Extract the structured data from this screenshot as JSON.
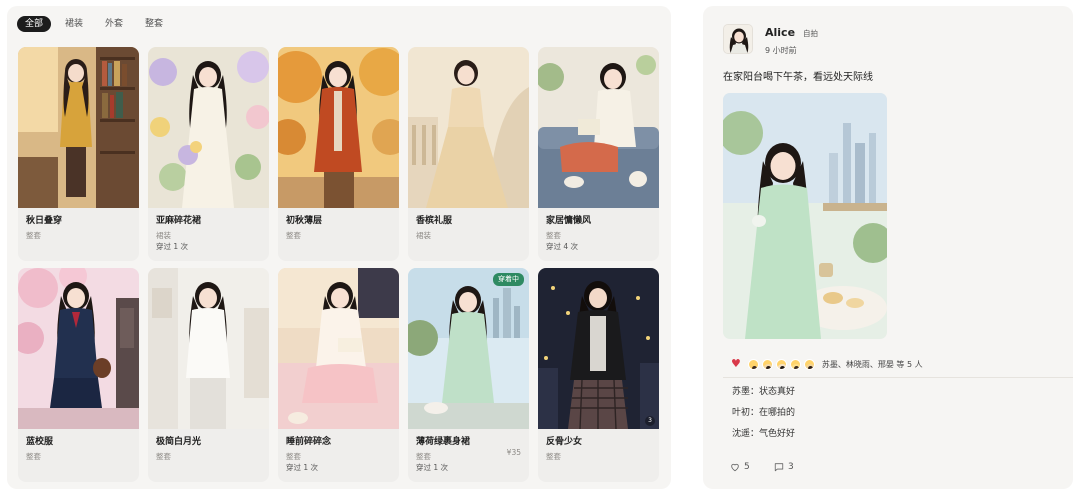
{
  "filters": {
    "all": "全部",
    "skirt": "裙装",
    "outerwear": "外套",
    "set": "整套"
  },
  "cards": [
    {
      "title": "秋日叠穿",
      "category": "整套",
      "worn": "",
      "price": "",
      "badge": "",
      "icon": "portrait-library-autumn"
    },
    {
      "title": "亚麻碎花裙",
      "category": "裙装",
      "worn": "穿过 1 次",
      "price": "",
      "badge": "",
      "icon": "portrait-flower-garden"
    },
    {
      "title": "初秋薄层",
      "category": "整套",
      "worn": "",
      "price": "",
      "badge": "",
      "icon": "portrait-autumn-trees"
    },
    {
      "title": "香槟礼服",
      "category": "裙装",
      "worn": "",
      "price": "",
      "badge": "",
      "icon": "portrait-staircase-gown"
    },
    {
      "title": "家居慵懒风",
      "category": "整套",
      "worn": "穿过 4 次",
      "price": "",
      "badge": "",
      "icon": "portrait-reading-sofa"
    },
    {
      "title": "蓝校服",
      "category": "整套",
      "worn": "",
      "price": "",
      "badge": "",
      "icon": "portrait-school-uniform"
    },
    {
      "title": "极简白月光",
      "category": "整套",
      "worn": "",
      "price": "",
      "badge": "",
      "icon": "portrait-white-room"
    },
    {
      "title": "睡前碎碎念",
      "category": "整套",
      "worn": "穿过 1 次",
      "price": "",
      "badge": "",
      "icon": "portrait-bedtime"
    },
    {
      "title": "薄荷绿裹身裙",
      "category": "整套",
      "worn": "穿过 1 次",
      "price": "¥35",
      "badge": "穿着中",
      "icon": "portrait-mint-dress"
    },
    {
      "title": "反骨少女",
      "category": "整套",
      "worn": "",
      "price": "",
      "badge": "",
      "icon": "portrait-night-city",
      "corner": "3"
    }
  ],
  "post": {
    "author": "Alice",
    "tag": "自拍",
    "time": "9 小时前",
    "text": "在家阳台喝下午茶，看远处天际线",
    "likers": "苏墨、林晓雨、邢晏 等 5 人",
    "comments": [
      "苏墨：状态真好",
      "叶初：在哪拍的",
      "沈遥：气色好好"
    ],
    "like_count": "5",
    "comment_count": "3"
  },
  "colors": {
    "accent_active_chip": "#1c1c1c",
    "badge_wearing": "#2e8a62",
    "heart": "#d9394a"
  }
}
